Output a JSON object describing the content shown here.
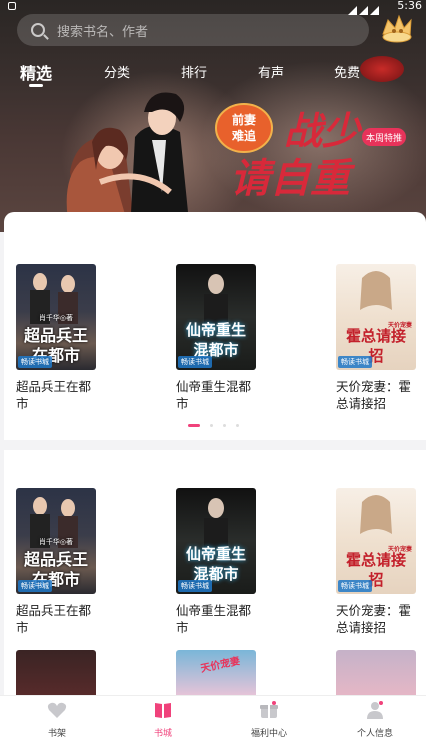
{
  "status": {
    "time": "5:36"
  },
  "search": {
    "placeholder": "搜索书名、作者"
  },
  "tabs": [
    {
      "label": "精选"
    },
    {
      "label": "分类"
    },
    {
      "label": "排行"
    },
    {
      "label": "有声"
    },
    {
      "label": "免费"
    }
  ],
  "banner": {
    "badge": "前妻难追",
    "title_line1": "战少",
    "title_line2": "请自重",
    "tag": "本周特推"
  },
  "section1": {
    "books": [
      {
        "title": "超品兵王在都市",
        "cover_text": "超品兵王在都市",
        "cover_author": "肖千华◎著",
        "brand": "畅读书城"
      },
      {
        "title": "仙帝重生混都市",
        "cover_text": "仙帝重生混都市",
        "brand": "畅读书城"
      },
      {
        "title": "天价宠妻：霍总请接招",
        "cover_text": "霍总请接招",
        "cover_tag": "天价宠妻",
        "brand": "畅读书城"
      }
    ],
    "carousel_pages": 4,
    "carousel_active": 0
  },
  "section2": {
    "books": [
      {
        "title": "超品兵王在都市",
        "cover_text": "超品兵王在都市",
        "cover_author": "肖千华◎著",
        "brand": "畅读书城"
      },
      {
        "title": "仙帝重生混都市",
        "cover_text": "仙帝重生混都市",
        "brand": "畅读书城"
      },
      {
        "title": "天价宠妻：霍总请接招",
        "cover_text": "霍总请接招",
        "cover_tag": "天价宠妻",
        "brand": "畅读书城"
      }
    ],
    "peek_text": "天价宠妻"
  },
  "nav": [
    {
      "label": "书架",
      "icon": "heart-icon"
    },
    {
      "label": "书城",
      "icon": "book-icon"
    },
    {
      "label": "福利中心",
      "icon": "gift-icon"
    },
    {
      "label": "个人信息",
      "icon": "user-icon"
    }
  ],
  "colors": {
    "accent": "#f0427b",
    "banner_red": "#c3202b"
  }
}
